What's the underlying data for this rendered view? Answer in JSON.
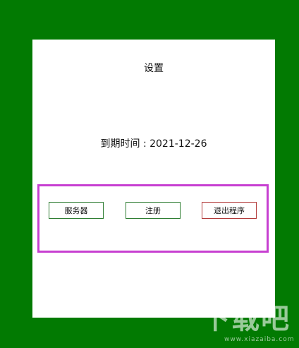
{
  "dialog": {
    "title": "设置",
    "expiry_text": "到期时间 : 2021-12-26"
  },
  "buttons": {
    "server": "服务器",
    "register": "注册",
    "exit": "退出程序"
  },
  "watermark": {
    "logo_text": "下载吧",
    "url": "www.xiazaiba.com"
  },
  "colors": {
    "background": "#027a02",
    "dialog": "#ffffff",
    "highlight": "#c73fd1",
    "green_border": "#2e7d32",
    "red_border": "#b23a3a"
  }
}
